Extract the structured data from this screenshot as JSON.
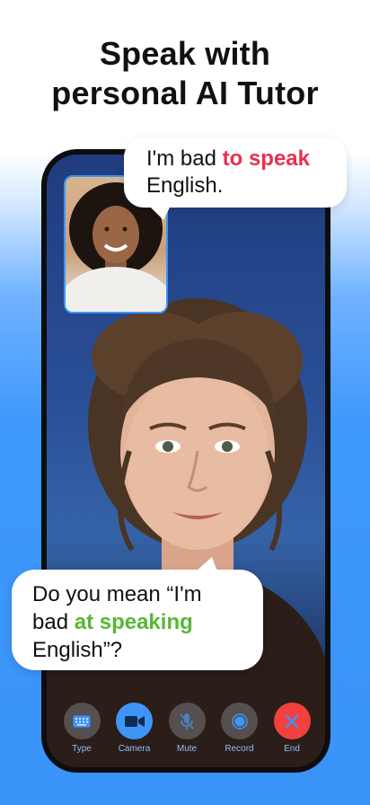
{
  "headline": {
    "line1": "Speak with",
    "line2": "personal AI Tutor"
  },
  "bubble_top": {
    "text_before": "I'm bad ",
    "highlight": "to speak",
    "text_after": "English.",
    "highlight_color": "#e8304f"
  },
  "bubble_bottom": {
    "line1": "Do you mean “I'm",
    "text_before": "bad ",
    "highlight": "at speaking",
    "line3": "English”?",
    "highlight_color": "#58b733"
  },
  "controls": [
    {
      "label": "Type",
      "icon": "keyboard-icon"
    },
    {
      "label": "Camera",
      "icon": "camera-icon"
    },
    {
      "label": "Mute",
      "icon": "mic-off-icon"
    },
    {
      "label": "Record",
      "icon": "record-icon"
    },
    {
      "label": "End",
      "icon": "close-icon"
    }
  ],
  "colors": {
    "accent_blue": "#3e95f7",
    "end_red": "#f2403f",
    "background_blue": "#3a93f8"
  }
}
